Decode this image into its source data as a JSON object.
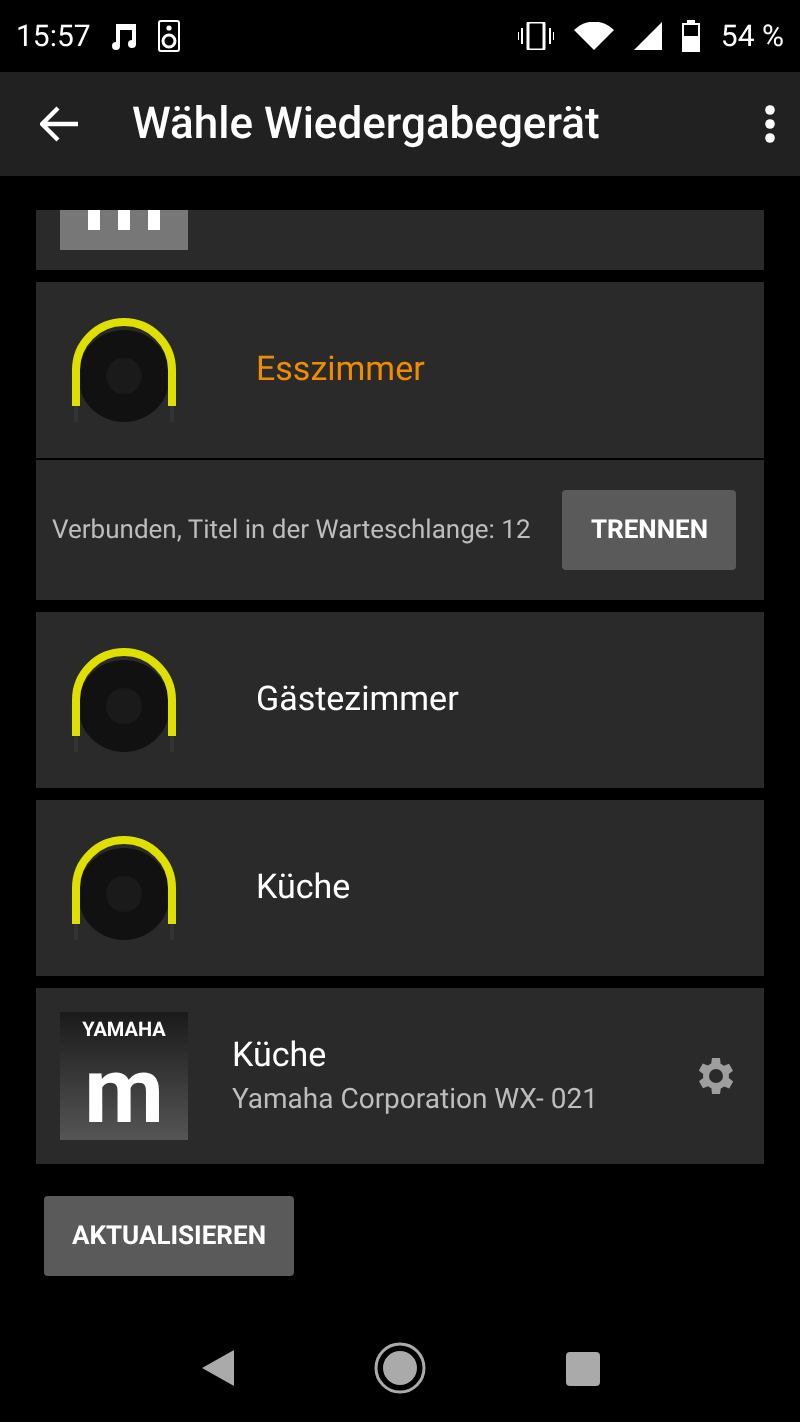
{
  "status_bar": {
    "time": "15:57",
    "battery": "54 %"
  },
  "app_bar": {
    "title": "Wähle Wiedergabegerät"
  },
  "devices": [
    {
      "kind": "cast",
      "name": "Esszimmer",
      "selected": true,
      "status": "Verbunden, Titel in der Warteschlange: 12",
      "action": "TRENNEN"
    },
    {
      "kind": "cast",
      "name": "Gästezimmer",
      "selected": false
    },
    {
      "kind": "cast",
      "name": "Küche",
      "selected": false
    },
    {
      "kind": "yamaha",
      "name": "Küche",
      "selected": false,
      "subtitle": "Yamaha Corporation WX- 021",
      "logo_brand": "YAMAHA",
      "logo_letter": "m"
    }
  ],
  "refresh_button": "AKTUALISIEREN"
}
